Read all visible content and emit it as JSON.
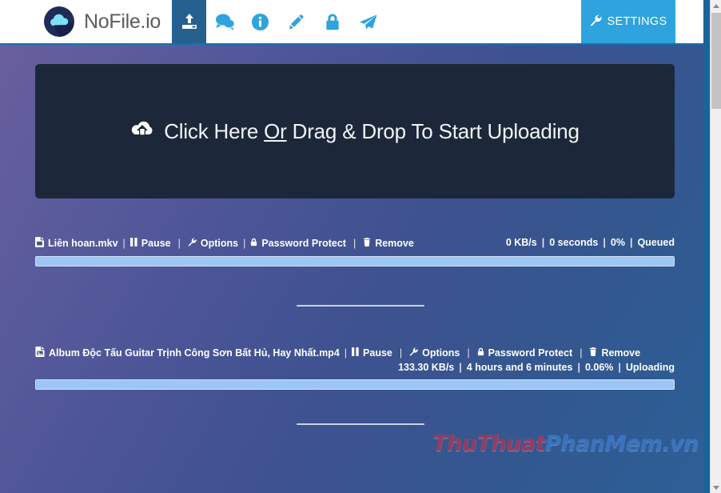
{
  "header": {
    "brand_name": "NoFile.io",
    "logo_icon": "cloud-logo-icon",
    "nav_items": [
      {
        "icon": "upload-icon",
        "label": "Upload",
        "active": true
      },
      {
        "icon": "chat-bubbles-icon",
        "label": "Chat",
        "active": false
      },
      {
        "icon": "info-circle-icon",
        "label": "Info",
        "active": false
      },
      {
        "icon": "pencil-icon",
        "label": "Edit",
        "active": false
      },
      {
        "icon": "lock-icon",
        "label": "Lock",
        "active": false
      },
      {
        "icon": "paper-plane-icon",
        "label": "Send",
        "active": false
      }
    ],
    "settings": {
      "label": "SETTINGS",
      "icon": "wrench-icon"
    }
  },
  "dropzone": {
    "icon": "cloud-upload-icon",
    "text_before": "Click Here ",
    "text_underlined": "Or",
    "text_after": " Drag & Drop To Start Uploading"
  },
  "files": [
    {
      "icon": "file-video-icon",
      "name": "Liên hoan.mkv",
      "actions": [
        {
          "icon": "pause-icon",
          "label": "Pause"
        },
        {
          "icon": "wrench-icon",
          "label": "Options"
        },
        {
          "icon": "lock-icon",
          "label": "Password Protect"
        },
        {
          "icon": "trash-icon",
          "label": "Remove"
        }
      ],
      "speed": "0 KB/s",
      "eta": "0 seconds",
      "percent": "0%",
      "state": "Queued",
      "progress_value": 0
    },
    {
      "icon": "file-image-icon",
      "name": "Album Độc Tấu Guitar Trịnh Công Sơn Bất Hủ, Hay Nhất.mp4",
      "actions": [
        {
          "icon": "pause-icon",
          "label": "Pause"
        },
        {
          "icon": "wrench-icon",
          "label": "Options"
        },
        {
          "icon": "lock-icon",
          "label": "Password Protect"
        },
        {
          "icon": "trash-icon",
          "label": "Remove"
        }
      ],
      "speed": "133.30 KB/s",
      "eta": "4 hours and 6 minutes",
      "percent": "0.06%",
      "state": "Uploading",
      "progress_value": 0.06
    }
  ],
  "separators": {
    "pipe": "|"
  },
  "watermark": {
    "part1": "ThuThuat",
    "part2": "PhanMem.vn"
  },
  "colors": {
    "accent_blue": "#2ea3dd",
    "nav_active": "#25608e",
    "dropzone_bg": "#1c2839",
    "progress_fill": "#8cbcf7",
    "watermark_red": "#a3385a",
    "watermark_blue": "#3a76c4"
  }
}
